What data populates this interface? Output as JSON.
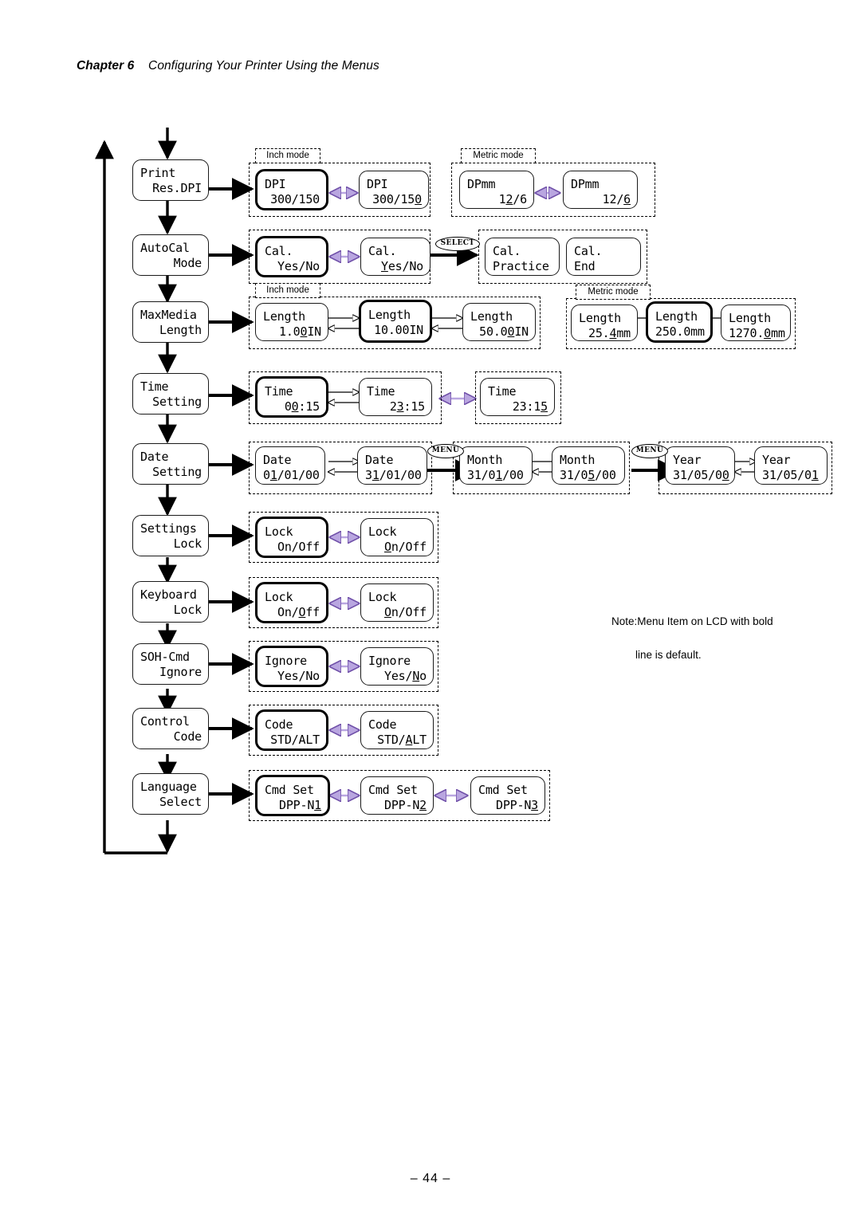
{
  "header": {
    "chapter": "Chapter 6",
    "title": "Configuring Your Printer Using the Menus"
  },
  "footer": {
    "page": "–  44  –"
  },
  "note": {
    "line1": "Note:Menu Item on LCD with bold",
    "line2": "line is default."
  },
  "labels": {
    "inch_mode": "Inch mode",
    "metric_mode": "Metric mode",
    "select_key": "SELECT",
    "menu_key": "MENU"
  },
  "menu_items": [
    {
      "name": "print-res-dpi",
      "l1": "Print",
      "l2": "Res.DPI"
    },
    {
      "name": "autocal-mode",
      "l1": "AutoCal",
      "l2": "Mode"
    },
    {
      "name": "maxmedia-length",
      "l1": "MaxMedia",
      "l2": "Length"
    },
    {
      "name": "time-setting",
      "l1": "Time",
      "l2": "Setting"
    },
    {
      "name": "date-setting",
      "l1": "Date",
      "l2": "Setting"
    },
    {
      "name": "settings-lock",
      "l1": "Settings",
      "l2": "Lock"
    },
    {
      "name": "keyboard-lock",
      "l1": "Keyboard",
      "l2": "Lock"
    },
    {
      "name": "soh-cmd-ignore",
      "l1": "SOH-Cmd",
      "l2": "Ignore"
    },
    {
      "name": "control-code",
      "l1": "Control",
      "l2": "Code"
    },
    {
      "name": "language-select",
      "l1": "Language",
      "l2": "Select"
    }
  ],
  "lcd": {
    "dpi_inch_1": {
      "l1": "DPI",
      "pre": "300/150",
      "u": "",
      "post": ""
    },
    "dpi_inch_2": {
      "l1": "DPI",
      "pre": "300/15",
      "u": "0",
      "post": ""
    },
    "dpmm_1": {
      "l1": "DPmm",
      "pre": "1",
      "u": "2",
      "post": "/6"
    },
    "dpmm_2": {
      "l1": "DPmm",
      "pre": "12/",
      "u": "6",
      "post": ""
    },
    "cal_1": {
      "l1": "Cal.",
      "pre": "Yes/No",
      "u": "",
      "post": ""
    },
    "cal_2": {
      "l1": "Cal.",
      "pre": "",
      "u": "Y",
      "post": "es/No"
    },
    "cal_practice": {
      "l1": "Cal.",
      "pre": "Practice",
      "u": "",
      "post": ""
    },
    "cal_end": {
      "l1": "Cal.",
      "pre": "End",
      "u": "",
      "post": ""
    },
    "len_in_1": {
      "l1": "Length",
      "pre": "1.0",
      "u": "0",
      "post": "IN"
    },
    "len_in_2": {
      "l1": "Length",
      "pre": "10.00IN",
      "u": "",
      "post": ""
    },
    "len_in_3": {
      "l1": "Length",
      "pre": "50.0",
      "u": "0",
      "post": "IN"
    },
    "len_mm_1": {
      "l1": "Length",
      "pre": "25.",
      "u": "4",
      "post": "mm"
    },
    "len_mm_2": {
      "l1": "Length",
      "pre": "250.0mm",
      "u": "",
      "post": ""
    },
    "len_mm_3": {
      "l1": "Length",
      "pre": "1270.",
      "u": "0",
      "post": "mm"
    },
    "time_1": {
      "l1": "Time",
      "pre": "0",
      "u": "0",
      "post": ":15"
    },
    "time_2": {
      "l1": "Time",
      "pre": "2",
      "u": "3",
      "post": ":15"
    },
    "time_3": {
      "l1": "Time",
      "pre": "23:1",
      "u": "5",
      "post": ""
    },
    "date_1": {
      "l1": "Date",
      "pre": "0",
      "u": "1",
      "post": "/01/00"
    },
    "date_2": {
      "l1": "Date",
      "pre": "3",
      "u": "1",
      "post": "/01/00"
    },
    "month_1": {
      "l1": "Month",
      "pre": "31/0",
      "u": "1",
      "post": "/00"
    },
    "month_2": {
      "l1": "Month",
      "pre": "31/0",
      "u": "5",
      "post": "/00"
    },
    "year_1": {
      "l1": "Year",
      "pre": "31/05/0",
      "u": "0",
      "post": ""
    },
    "year_2": {
      "l1": "Year",
      "pre": "31/05/0",
      "u": "1",
      "post": ""
    },
    "slock_1": {
      "l1": "Lock",
      "pre": "On/Off",
      "u": "",
      "post": ""
    },
    "slock_2": {
      "l1": "Lock",
      "pre": "",
      "u": "O",
      "post": "n/Off"
    },
    "klock_1": {
      "l1": "Lock",
      "pre": "On/",
      "u": "O",
      "post": "ff"
    },
    "klock_2": {
      "l1": "Lock",
      "pre": "",
      "u": "O",
      "post": "n/Off"
    },
    "ignore_1": {
      "l1": "Ignore",
      "pre": "Yes/No",
      "u": "",
      "post": ""
    },
    "ignore_2": {
      "l1": "Ignore",
      "pre": "Yes/",
      "u": "N",
      "post": "o"
    },
    "code_1": {
      "l1": "Code",
      "pre": "STD/ALT",
      "u": "",
      "post": ""
    },
    "code_2": {
      "l1": "Code",
      "pre": "STD/",
      "u": "A",
      "post": "LT"
    },
    "cmd_1": {
      "l1": "Cmd Set",
      "pre": "DPP-N",
      "u": "1",
      "post": ""
    },
    "cmd_2": {
      "l1": "Cmd Set",
      "pre": "DPP-N",
      "u": "2",
      "post": ""
    },
    "cmd_3": {
      "l1": "Cmd Set",
      "pre": "DPP-N",
      "u": "3",
      "post": ""
    }
  }
}
